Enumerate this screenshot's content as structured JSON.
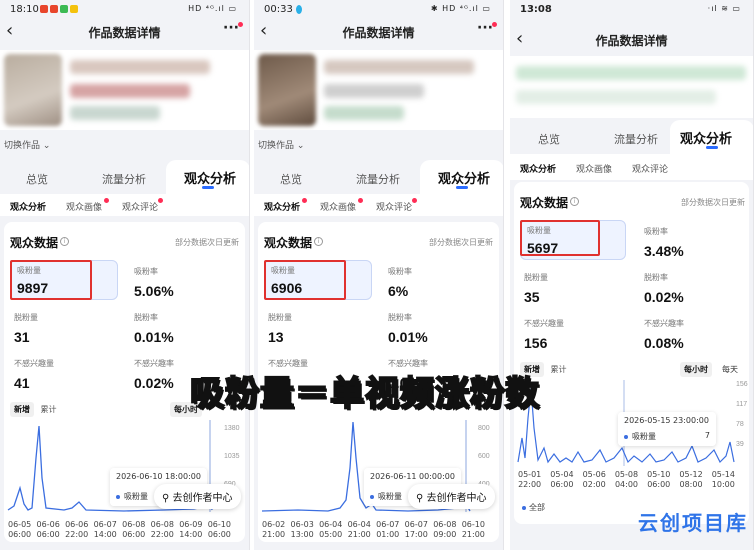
{
  "phones": [
    {
      "status_time": "18:10",
      "status_right": "HD ⁴ᴳ.ıl ▭",
      "nav_title": "作品数据详情",
      "switch_label": "切换作品 ⌄",
      "tabs": [
        "总览",
        "流量分析",
        "观众分析"
      ],
      "subtabs": [
        "观众分析",
        "观众画像",
        "观众评论"
      ],
      "section_title": "观众数据",
      "update_note": "部分数据次日更新",
      "metrics": [
        {
          "label": "吸粉量",
          "value": "9897"
        },
        {
          "label": "吸粉率",
          "value": "5.06%"
        },
        {
          "label": "脱粉量",
          "value": "31"
        },
        {
          "label": "脱粉率",
          "value": "0.01%"
        },
        {
          "label": "不感兴趣量",
          "value": "41"
        },
        {
          "label": "不感兴趣率",
          "value": "0.02%"
        }
      ],
      "chart_tabs": [
        "新增",
        "累计"
      ],
      "hourly": "每小时",
      "y_ticks": [
        "1380",
        "1035",
        "690"
      ],
      "tooltip_time": "2026-06-10 18:00:00",
      "tooltip_series": "吸粉量",
      "creator_center": "去创作者中心",
      "x_labels": [
        [
          "06-05",
          "06:00"
        ],
        [
          "06-06",
          "06:00"
        ],
        [
          "06-06",
          "22:00"
        ],
        [
          "06-07",
          "14:00"
        ],
        [
          "06-08",
          "06:00"
        ],
        [
          "06-08",
          "22:00"
        ],
        [
          "06-09",
          "14:00"
        ],
        [
          "06-10",
          "06:00"
        ]
      ]
    },
    {
      "status_time": "00:33",
      "status_right": "✱ HD ⁴ᴳ.ıl ▭",
      "nav_title": "作品数据详情",
      "switch_label": "切换作品 ⌄",
      "tabs": [
        "总览",
        "流量分析",
        "观众分析"
      ],
      "subtabs": [
        "观众分析",
        "观众画像",
        "观众评论"
      ],
      "section_title": "观众数据",
      "update_note": "部分数据次日更新",
      "metrics": [
        {
          "label": "吸粉量",
          "value": "6906"
        },
        {
          "label": "吸粉率",
          "value": "6%"
        },
        {
          "label": "脱粉量",
          "value": "13"
        },
        {
          "label": "脱粉率",
          "value": "0.01%"
        },
        {
          "label": "不感兴趣量",
          "value": "39"
        },
        {
          "label": "不感兴趣率",
          "value": "0.03%"
        }
      ],
      "y_ticks": [
        "800",
        "600",
        "400"
      ],
      "tooltip_time": "2026-06-11 00:00:00",
      "tooltip_series": "吸粉量",
      "creator_center": "去创作者中心",
      "x_labels": [
        [
          "06-02",
          "21:00"
        ],
        [
          "06-03",
          "13:00"
        ],
        [
          "06-04",
          "05:00"
        ],
        [
          "06-04",
          "21:00"
        ],
        [
          "06-07",
          "01:00"
        ],
        [
          "06-07",
          "17:00"
        ],
        [
          "06-08",
          "09:00"
        ],
        [
          "06-10",
          "21:00"
        ]
      ]
    },
    {
      "status_time": "13:08",
      "status_right": "·ıl ≋ ▭",
      "nav_title": "作品数据详情",
      "tabs": [
        "总览",
        "流量分析",
        "观众分析"
      ],
      "subtabs": [
        "观众分析",
        "观众画像",
        "观众评论"
      ],
      "section_title": "观众数据",
      "update_note": "部分数据次日更新",
      "metrics": [
        {
          "label": "吸粉量",
          "value": "5697"
        },
        {
          "label": "吸粉率",
          "value": "3.48%"
        },
        {
          "label": "脱粉量",
          "value": "35"
        },
        {
          "label": "脱粉率",
          "value": "0.02%"
        },
        {
          "label": "不感兴趣量",
          "value": "156"
        },
        {
          "label": "不感兴趣率",
          "value": "0.08%"
        }
      ],
      "chart_tabs": [
        "新增",
        "累计"
      ],
      "hourly": "每小时",
      "daily": "每天",
      "y_ticks": [
        "156",
        "117",
        "78",
        "39"
      ],
      "tooltip_time": "2026-05-15 23:00:00",
      "tooltip_series": "吸粉量",
      "tooltip_value": "7",
      "legend": "全部",
      "x_labels": [
        [
          "05-01",
          "22:00"
        ],
        [
          "05-04",
          "06:00"
        ],
        [
          "05-06",
          "02:00"
        ],
        [
          "05-08",
          "04:00"
        ],
        [
          "05-10",
          "06:00"
        ],
        [
          "05-12",
          "08:00"
        ],
        [
          "05-14",
          "10:00"
        ]
      ]
    }
  ],
  "overlay_caption": "吸粉量＝单视频涨粉数",
  "watermark": "云创项目库",
  "colors": {
    "accent": "#2b6cff",
    "line": "#3b6ee0",
    "highlight_box": "#e0312f"
  }
}
